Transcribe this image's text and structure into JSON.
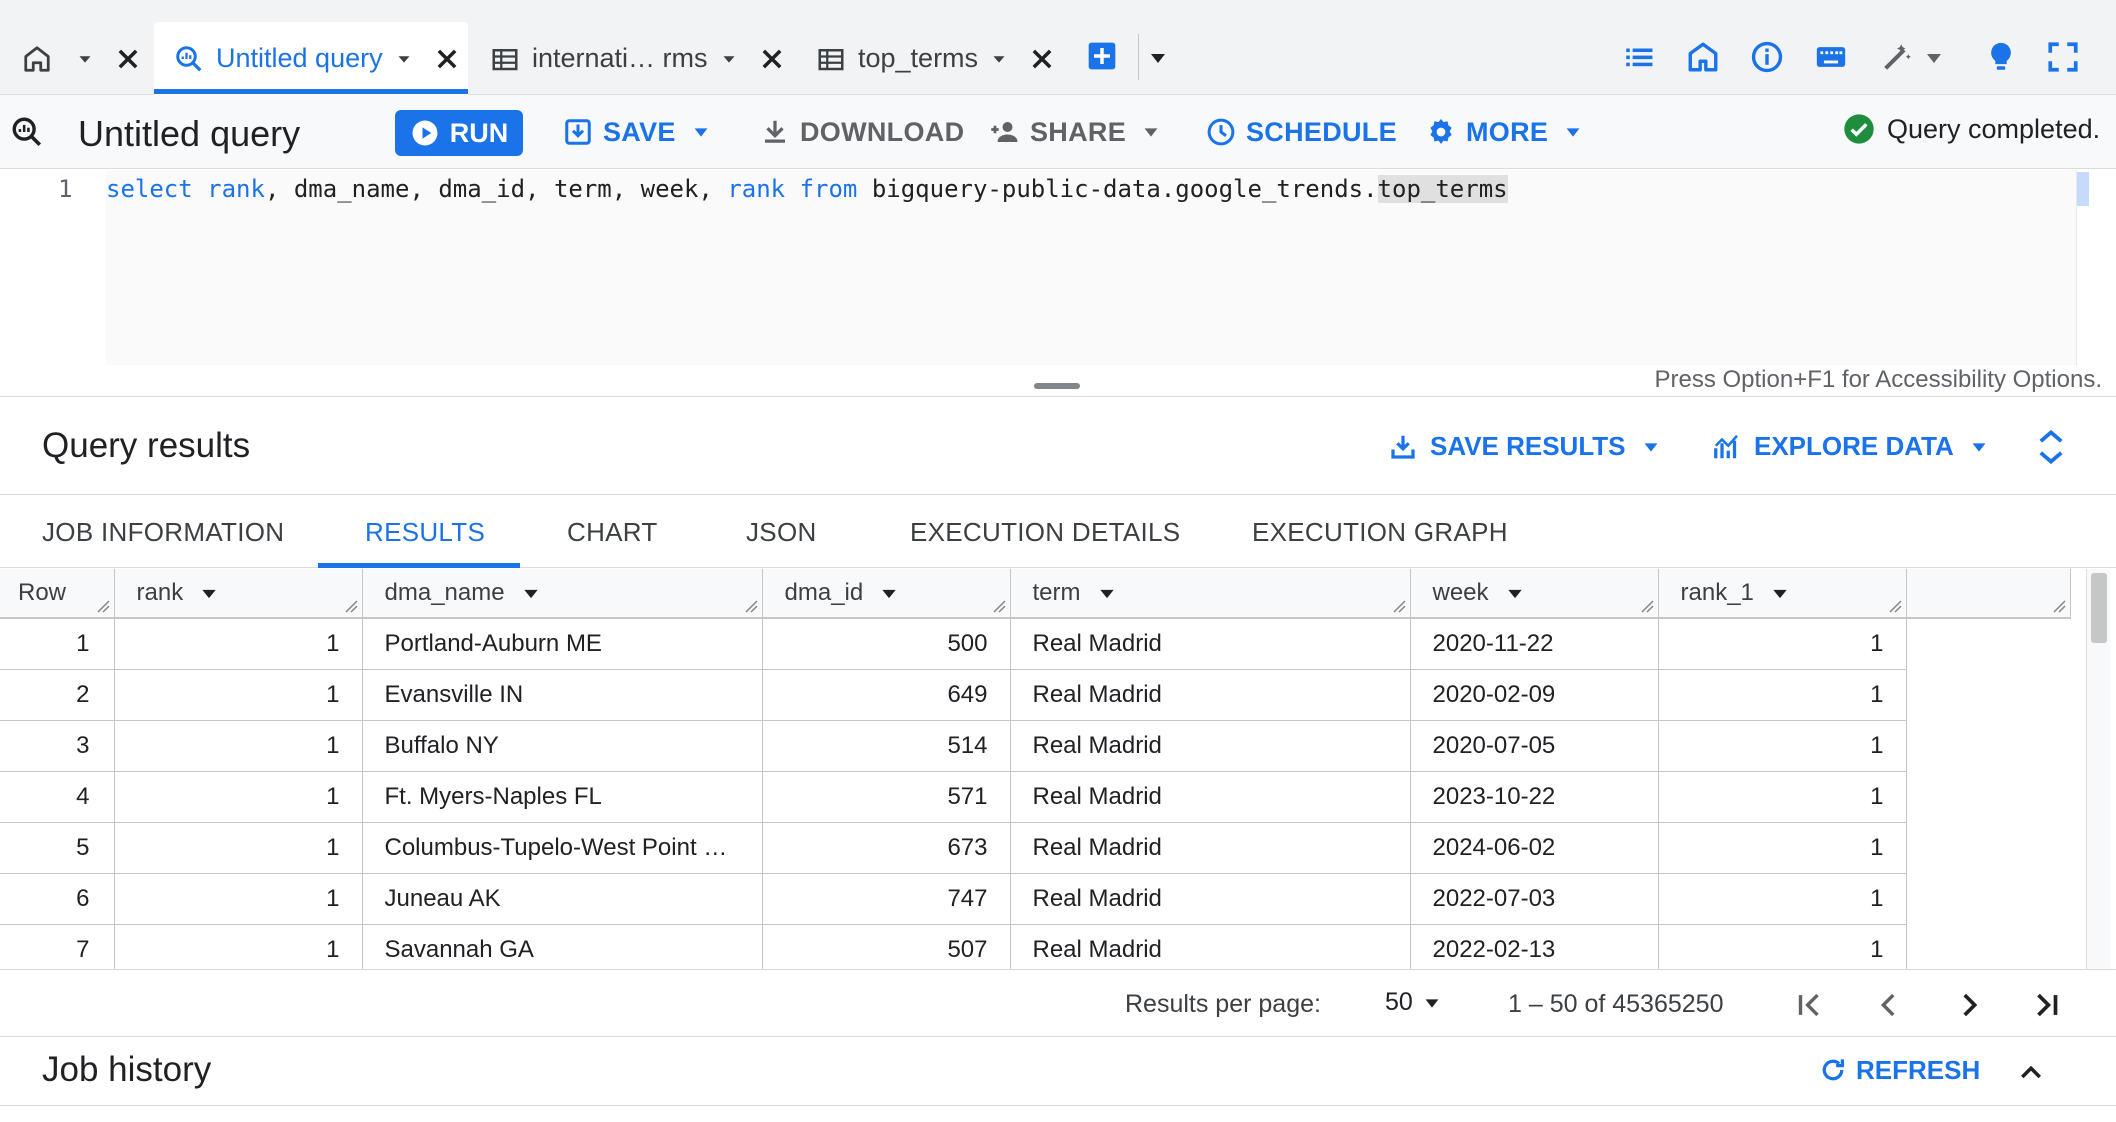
{
  "tabs": [
    {
      "label": "Untitled query",
      "active": true
    },
    {
      "label": "internati…  rms",
      "active": false
    },
    {
      "label": "top_terms",
      "active": false
    }
  ],
  "toolbar": {
    "query_title": "Untitled query",
    "run_label": "RUN",
    "save_label": "SAVE",
    "download_label": "DOWNLOAD",
    "share_label": "SHARE",
    "schedule_label": "SCHEDULE",
    "more_label": "MORE",
    "status_text": "Query completed."
  },
  "editor": {
    "line_number": "1",
    "code_tokens": [
      {
        "text": "select",
        "kw": true
      },
      {
        "text": " ",
        "kw": false
      },
      {
        "text": "rank",
        "kw": true
      },
      {
        "text": ", dma_name, dma_id, term, week, ",
        "kw": false
      },
      {
        "text": "rank",
        "kw": true
      },
      {
        "text": " ",
        "kw": false
      },
      {
        "text": "from",
        "kw": true
      },
      {
        "text": " bigquery-public-data.google_trends.",
        "kw": false
      },
      {
        "text": "top_terms",
        "kw": false,
        "highlight": true
      }
    ],
    "accessibility_hint": "Press Option+F1 for Accessibility Options."
  },
  "results": {
    "title": "Query results",
    "save_results_label": "SAVE RESULTS",
    "explore_data_label": "EXPLORE DATA",
    "tabs": [
      "JOB INFORMATION",
      "RESULTS",
      "CHART",
      "JSON",
      "EXECUTION DETAILS",
      "EXECUTION GRAPH"
    ],
    "active_tab": "RESULTS",
    "columns": [
      "Row",
      "rank",
      "dma_name",
      "dma_id",
      "term",
      "week",
      "rank_1"
    ],
    "rows": [
      [
        "1",
        "1",
        "Portland-Auburn ME",
        "500",
        "Real Madrid",
        "2020-11-22",
        "1"
      ],
      [
        "2",
        "1",
        "Evansville IN",
        "649",
        "Real Madrid",
        "2020-02-09",
        "1"
      ],
      [
        "3",
        "1",
        "Buffalo NY",
        "514",
        "Real Madrid",
        "2020-07-05",
        "1"
      ],
      [
        "4",
        "1",
        "Ft. Myers-Naples FL",
        "571",
        "Real Madrid",
        "2023-10-22",
        "1"
      ],
      [
        "5",
        "1",
        "Columbus-Tupelo-West Point …",
        "673",
        "Real Madrid",
        "2024-06-02",
        "1"
      ],
      [
        "6",
        "1",
        "Juneau AK",
        "747",
        "Real Madrid",
        "2022-07-03",
        "1"
      ],
      [
        "7",
        "1",
        "Savannah GA",
        "507",
        "Real Madrid",
        "2022-02-13",
        "1"
      ]
    ]
  },
  "pagination": {
    "per_page_label": "Results per page:",
    "per_page_value": "50",
    "range_text": "1 – 50 of 45365250"
  },
  "job_history": {
    "title": "Job history",
    "refresh_label": "REFRESH"
  },
  "colors": {
    "accent": "#1a73e8",
    "success": "#1e8e3e"
  }
}
